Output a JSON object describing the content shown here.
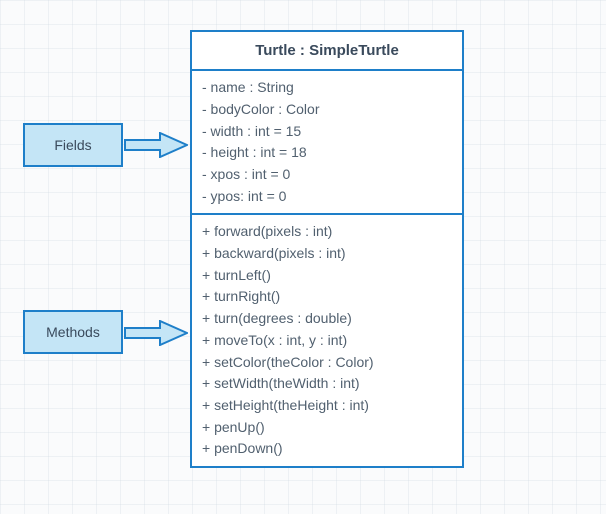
{
  "labels": {
    "fields": "Fields",
    "methods": "Methods"
  },
  "uml": {
    "title": "Turtle : SimpleTurtle",
    "fields": [
      "- name : String",
      "- bodyColor : Color",
      "- width : int = 15",
      "- height : int = 18",
      "- xpos : int = 0",
      "- ypos: int = 0"
    ],
    "methods": [
      "+ forward(pixels : int)",
      "+ backward(pixels : int)",
      "+ turnLeft()",
      "+ turnRight()",
      "+ turn(degrees : double)",
      "+ moveTo(x : int, y : int)",
      "+ setColor(theColor : Color)",
      "+ setWidth(theWidth : int)",
      "+ setHeight(theHeight : int)",
      "+ penUp()",
      "+ penDown()"
    ]
  },
  "chart_data": {
    "type": "uml-class",
    "class_name": "Turtle",
    "class_type": "SimpleTurtle",
    "fields": [
      {
        "visibility": "-",
        "name": "name",
        "type": "String",
        "default": null
      },
      {
        "visibility": "-",
        "name": "bodyColor",
        "type": "Color",
        "default": null
      },
      {
        "visibility": "-",
        "name": "width",
        "type": "int",
        "default": 15
      },
      {
        "visibility": "-",
        "name": "height",
        "type": "int",
        "default": 18
      },
      {
        "visibility": "-",
        "name": "xpos",
        "type": "int",
        "default": 0
      },
      {
        "visibility": "-",
        "name": "ypos",
        "type": "int",
        "default": 0
      }
    ],
    "methods": [
      {
        "visibility": "+",
        "name": "forward",
        "params": [
          {
            "name": "pixels",
            "type": "int"
          }
        ]
      },
      {
        "visibility": "+",
        "name": "backward",
        "params": [
          {
            "name": "pixels",
            "type": "int"
          }
        ]
      },
      {
        "visibility": "+",
        "name": "turnLeft",
        "params": []
      },
      {
        "visibility": "+",
        "name": "turnRight",
        "params": []
      },
      {
        "visibility": "+",
        "name": "turn",
        "params": [
          {
            "name": "degrees",
            "type": "double"
          }
        ]
      },
      {
        "visibility": "+",
        "name": "moveTo",
        "params": [
          {
            "name": "x",
            "type": "int"
          },
          {
            "name": "y",
            "type": "int"
          }
        ]
      },
      {
        "visibility": "+",
        "name": "setColor",
        "params": [
          {
            "name": "theColor",
            "type": "Color"
          }
        ]
      },
      {
        "visibility": "+",
        "name": "setWidth",
        "params": [
          {
            "name": "theWidth",
            "type": "int"
          }
        ]
      },
      {
        "visibility": "+",
        "name": "setHeight",
        "params": [
          {
            "name": "theHeight",
            "type": "int"
          }
        ]
      },
      {
        "visibility": "+",
        "name": "penUp",
        "params": []
      },
      {
        "visibility": "+",
        "name": "penDown",
        "params": []
      }
    ],
    "callouts": [
      {
        "label": "Fields",
        "points_to": "fields"
      },
      {
        "label": "Methods",
        "points_to": "methods"
      }
    ]
  }
}
